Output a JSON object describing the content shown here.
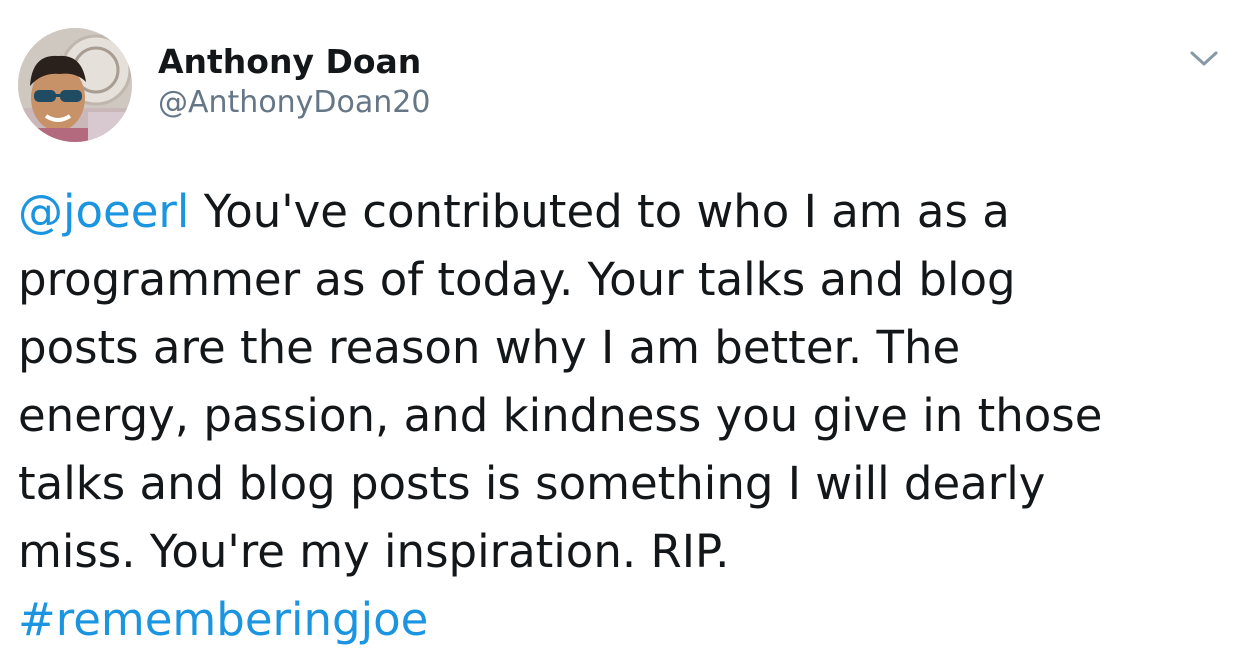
{
  "tweet": {
    "author": {
      "name": "Anthony Doan",
      "handle": "@AnthonyDoan20"
    },
    "body": {
      "mention": "@joeerl",
      "line1_rest": " You've contributed to who I am as a",
      "line2": "programmer as of today. Your talks and blog",
      "line3": "posts are the reason why I am better. The",
      "line4": "energy, passion, and kindness you give in those",
      "line5": "talks and blog posts is something I will dearly",
      "line6": "miss. You're my inspiration. RIP.",
      "hashtag": "#rememberingjoe"
    },
    "icons": {
      "menu": "chevron-down-icon"
    }
  },
  "colors": {
    "link": "#1b95e0",
    "text": "#14171a",
    "secondary": "#657786"
  }
}
